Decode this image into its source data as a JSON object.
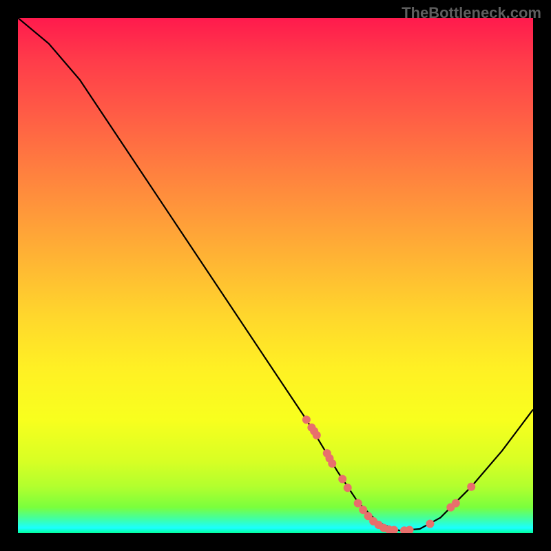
{
  "watermark": "TheBottleneck.com",
  "chart_data": {
    "type": "line",
    "title": "",
    "xlabel": "",
    "ylabel": "",
    "xlim": [
      0,
      100
    ],
    "ylim": [
      0,
      100
    ],
    "curve": [
      {
        "x": 0,
        "y": 100
      },
      {
        "x": 6,
        "y": 95
      },
      {
        "x": 12,
        "y": 88
      },
      {
        "x": 20,
        "y": 76
      },
      {
        "x": 30,
        "y": 61
      },
      {
        "x": 40,
        "y": 46
      },
      {
        "x": 50,
        "y": 31
      },
      {
        "x": 56,
        "y": 22
      },
      {
        "x": 62,
        "y": 12
      },
      {
        "x": 66,
        "y": 6
      },
      {
        "x": 70,
        "y": 2
      },
      {
        "x": 74,
        "y": 0.5
      },
      {
        "x": 78,
        "y": 0.8
      },
      {
        "x": 82,
        "y": 3
      },
      {
        "x": 88,
        "y": 9
      },
      {
        "x": 94,
        "y": 16
      },
      {
        "x": 100,
        "y": 24
      }
    ],
    "points": [
      {
        "x": 56,
        "y": 22
      },
      {
        "x": 57,
        "y": 20.5
      },
      {
        "x": 57.5,
        "y": 19.8
      },
      {
        "x": 58,
        "y": 19
      },
      {
        "x": 60,
        "y": 15.5
      },
      {
        "x": 60.5,
        "y": 14.5
      },
      {
        "x": 61,
        "y": 13.5
      },
      {
        "x": 63,
        "y": 10.5
      },
      {
        "x": 64,
        "y": 8.8
      },
      {
        "x": 66,
        "y": 5.8
      },
      {
        "x": 67,
        "y": 4.5
      },
      {
        "x": 68,
        "y": 3.3
      },
      {
        "x": 69,
        "y": 2.3
      },
      {
        "x": 70,
        "y": 1.6
      },
      {
        "x": 71,
        "y": 1.0
      },
      {
        "x": 72,
        "y": 0.7
      },
      {
        "x": 73,
        "y": 0.6
      },
      {
        "x": 75,
        "y": 0.5
      },
      {
        "x": 76,
        "y": 0.6
      },
      {
        "x": 80,
        "y": 1.8
      },
      {
        "x": 84,
        "y": 5.0
      },
      {
        "x": 85,
        "y": 5.8
      },
      {
        "x": 88,
        "y": 9.0
      }
    ]
  }
}
